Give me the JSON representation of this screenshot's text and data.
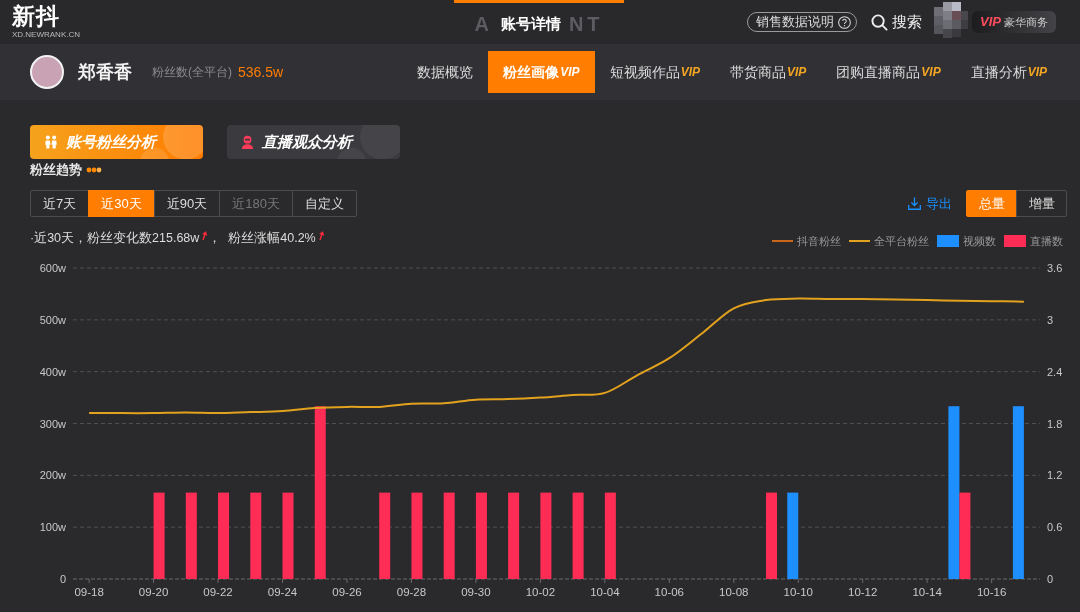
{
  "header": {
    "logo": {
      "text": "新抖",
      "subtitle": "XD.NEWRANK.CN"
    },
    "title": "账号详情",
    "title_backdrop": [
      "A",
      "NT"
    ],
    "help_link": {
      "label": "销售数据说明"
    },
    "search": {
      "label": "搜索"
    },
    "vip_badge": {
      "tag": "VIP",
      "label": "豪华商务"
    }
  },
  "profile": {
    "name": "郑香香",
    "stat_label": "粉丝数(全平台)",
    "stat_value": "536.5w"
  },
  "nav": [
    {
      "label": "数据概览",
      "selected": false
    },
    {
      "label": "粉丝画像",
      "badge": "VIP",
      "selected": true
    },
    {
      "label": "短视频作品",
      "badge": "VIP",
      "selected": false
    },
    {
      "label": "带货商品",
      "badge": "VIP",
      "selected": false
    },
    {
      "label": "团购直播商品",
      "badge": "VIP",
      "selected": false
    },
    {
      "label": "直播分析",
      "badge": "VIP",
      "selected": false
    }
  ],
  "section_tabs": [
    {
      "label": "账号粉丝分析",
      "selected": true
    },
    {
      "label": "直播观众分析",
      "selected": false
    }
  ],
  "section_title": "粉丝趋势",
  "ranges": [
    {
      "label": "近7天",
      "selected": false,
      "disabled": false
    },
    {
      "label": "近30天",
      "selected": true,
      "disabled": false
    },
    {
      "label": "近90天",
      "selected": false,
      "disabled": false
    },
    {
      "label": "近180天",
      "selected": false,
      "disabled": true
    },
    {
      "label": "自定义",
      "selected": false,
      "disabled": false
    }
  ],
  "export": {
    "label": "导出"
  },
  "modes": [
    {
      "label": "总量",
      "selected": true
    },
    {
      "label": "增量",
      "selected": false
    }
  ],
  "summary": [
    {
      "text": "·近30天，粉丝变化数215.68w",
      "rising": true
    },
    {
      "text": "，  粉丝涨幅40.2%",
      "rising": true
    }
  ],
  "chart_data": {
    "type": "bar",
    "stacked": false,
    "grid": true,
    "categories": [
      "09-18",
      null,
      "09-20",
      null,
      "09-22",
      null,
      "09-24",
      null,
      "09-26",
      null,
      "09-28",
      null,
      "09-30",
      null,
      "10-02",
      null,
      "10-04",
      null,
      "10-06",
      null,
      "10-08",
      null,
      "10-10",
      null,
      "10-12",
      null,
      "10-14",
      null,
      "10-16",
      null
    ],
    "ylim": [
      0,
      600
    ],
    "yticks": [
      {
        "value": 0,
        "label": "0"
      },
      {
        "value": 100,
        "label": "100w"
      },
      {
        "value": 200,
        "label": "200w"
      },
      {
        "value": 300,
        "label": "300w"
      },
      {
        "value": 400,
        "label": "400w"
      },
      {
        "value": 500,
        "label": "500w"
      },
      {
        "value": 600,
        "label": "600w"
      }
    ],
    "y2lim": [
      0,
      3.6
    ],
    "y2ticks": [
      {
        "value": 0,
        "label": "0"
      },
      {
        "value": 0.6,
        "label": "0.6"
      },
      {
        "value": 1.2,
        "label": "1.2"
      },
      {
        "value": 1.8,
        "label": "1.8"
      },
      {
        "value": 2.4,
        "label": "2.4"
      },
      {
        "value": 3,
        "label": "3"
      },
      {
        "value": 3.6,
        "label": "3.6"
      }
    ],
    "series": [
      {
        "name": "抖音粉丝",
        "type": "line",
        "color": "#c9681c",
        "values": [
          null,
          null,
          null,
          null,
          null,
          null,
          null,
          null,
          null,
          null,
          null,
          null,
          null,
          null,
          null,
          null,
          null,
          null,
          null,
          null,
          null,
          null,
          null,
          null,
          null,
          null,
          null,
          null,
          null,
          null
        ]
      },
      {
        "name": "全平台粉丝",
        "type": "line",
        "color": "#e2a21e",
        "values": [
          320,
          320,
          320,
          321,
          320,
          322,
          324,
          330,
          332,
          332,
          338,
          339,
          346,
          347,
          350,
          355,
          359,
          393,
          426,
          473,
          522,
          538,
          541,
          540,
          540,
          539,
          538,
          537,
          536,
          535
        ]
      },
      {
        "name": "视频数",
        "axis": "y2",
        "color": "#1e8fff",
        "values": [
          0,
          0,
          0,
          0,
          0,
          0,
          0,
          0,
          0,
          0,
          0,
          0,
          0,
          0,
          0,
          0,
          0,
          0,
          0,
          0,
          0,
          0,
          1,
          0,
          0,
          0,
          0,
          2,
          0,
          2
        ]
      },
      {
        "name": "直播数",
        "axis": "y2",
        "color": "#ff2d55",
        "values": [
          0,
          0,
          1,
          1,
          1,
          1,
          1,
          2,
          0,
          1,
          1,
          1,
          1,
          1,
          1,
          1,
          1,
          0,
          0,
          0,
          0,
          1,
          0,
          0,
          0,
          0,
          0,
          1,
          0,
          0
        ]
      }
    ]
  }
}
